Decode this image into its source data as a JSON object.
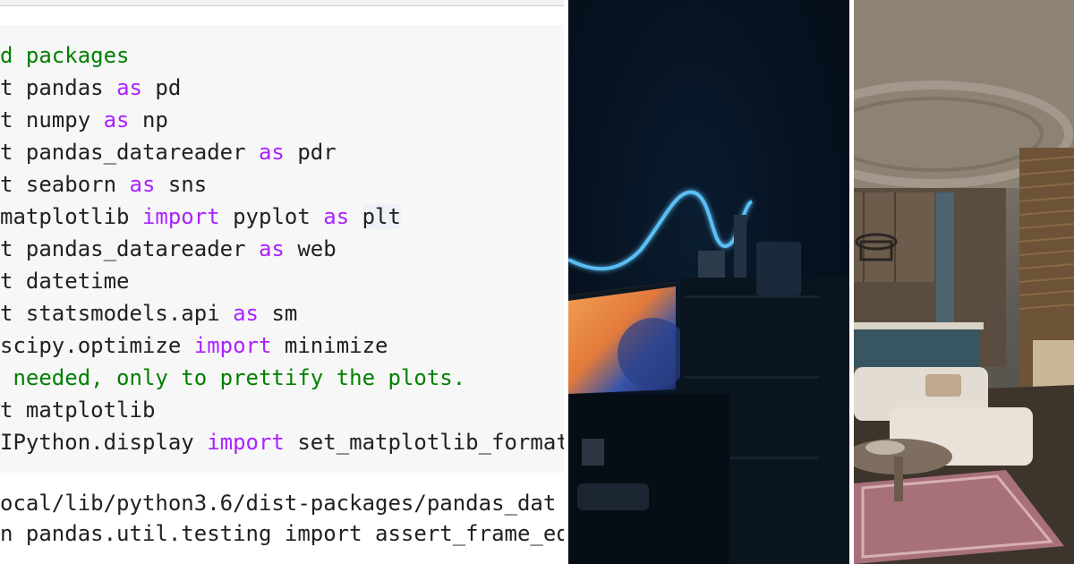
{
  "code": {
    "lines": [
      [
        {
          "t": "d packages",
          "c": "cm"
        }
      ],
      [
        {
          "t": "t ",
          "c": ""
        },
        {
          "t": "pandas ",
          "c": ""
        },
        {
          "t": "as",
          "c": "kw"
        },
        {
          "t": " pd",
          "c": ""
        }
      ],
      [
        {
          "t": "t numpy ",
          "c": ""
        },
        {
          "t": "as",
          "c": "kw"
        },
        {
          "t": " np",
          "c": ""
        }
      ],
      [
        {
          "t": "t pandas_datareader ",
          "c": ""
        },
        {
          "t": "as",
          "c": "kw"
        },
        {
          "t": " pdr",
          "c": ""
        }
      ],
      [
        {
          "t": "t seaborn ",
          "c": ""
        },
        {
          "t": "as",
          "c": "kw"
        },
        {
          "t": " sns",
          "c": ""
        }
      ],
      [
        {
          "t": "matplotlib ",
          "c": ""
        },
        {
          "t": "import",
          "c": "kw"
        },
        {
          "t": " pyplot ",
          "c": ""
        },
        {
          "t": "as",
          "c": "kw"
        },
        {
          "t": " ",
          "c": ""
        },
        {
          "t": "plt",
          "c": "hl"
        }
      ],
      [
        {
          "t": "t pandas_datareader ",
          "c": ""
        },
        {
          "t": "as",
          "c": "kw"
        },
        {
          "t": " web",
          "c": ""
        }
      ],
      [
        {
          "t": "t datetime",
          "c": ""
        }
      ],
      [
        {
          "t": "t statsmodels.api ",
          "c": ""
        },
        {
          "t": "as",
          "c": "kw"
        },
        {
          "t": " sm",
          "c": ""
        }
      ],
      [
        {
          "t": "scipy.optimize ",
          "c": ""
        },
        {
          "t": "import",
          "c": "kw"
        },
        {
          "t": " minimize",
          "c": ""
        }
      ],
      [
        {
          "t": " needed, only to prettify the plots.",
          "c": "cm"
        }
      ],
      [
        {
          "t": "t matplotlib",
          "c": ""
        }
      ],
      [
        {
          "t": "IPython.display ",
          "c": ""
        },
        {
          "t": "import",
          "c": "kw"
        },
        {
          "t": " set_matplotlib_format",
          "c": ""
        }
      ]
    ],
    "output_lines": [
      "ocal/lib/python3.6/dist-packages/pandas_dat",
      "n pandas.util.testing import assert_frame_eq"
    ]
  },
  "colors": {
    "keyword": "#aa22ff",
    "comment": "#008000",
    "text": "#212121",
    "cell_background": "#f7f7f7"
  },
  "photos": [
    {
      "subject": "dark-room-neon-monitor"
    },
    {
      "subject": "living-room-interior"
    }
  ]
}
